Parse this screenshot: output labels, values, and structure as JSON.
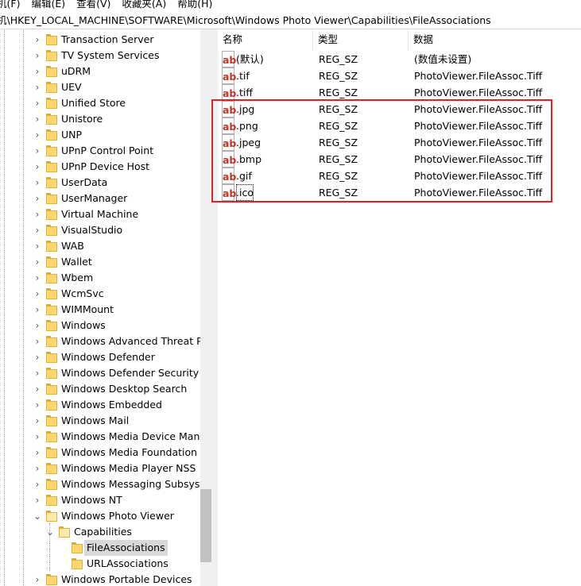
{
  "menu": [
    "机(F)",
    "编辑(E)",
    "查看(V)",
    "收藏夹(A)",
    "帮助(H)"
  ],
  "address": "机\\HKEY_LOCAL_MACHINE\\SOFTWARE\\Microsoft\\Windows Photo Viewer\\Capabilities\\FileAssociations",
  "tree": {
    "items": [
      {
        "label": "Transaction Server",
        "level": 1,
        "expand": "collapsed"
      },
      {
        "label": "TV System Services",
        "level": 1,
        "expand": "collapsed"
      },
      {
        "label": "uDRM",
        "level": 1,
        "expand": "collapsed"
      },
      {
        "label": "UEV",
        "level": 1,
        "expand": "collapsed"
      },
      {
        "label": "Unified Store",
        "level": 1,
        "expand": "collapsed"
      },
      {
        "label": "Unistore",
        "level": 1,
        "expand": "collapsed"
      },
      {
        "label": "UNP",
        "level": 1,
        "expand": "collapsed"
      },
      {
        "label": "UPnP Control Point",
        "level": 1,
        "expand": "collapsed"
      },
      {
        "label": "UPnP Device Host",
        "level": 1,
        "expand": "collapsed"
      },
      {
        "label": "UserData",
        "level": 1,
        "expand": "collapsed"
      },
      {
        "label": "UserManager",
        "level": 1,
        "expand": "collapsed"
      },
      {
        "label": "Virtual Machine",
        "level": 1,
        "expand": "collapsed"
      },
      {
        "label": "VisualStudio",
        "level": 1,
        "expand": "collapsed"
      },
      {
        "label": "WAB",
        "level": 1,
        "expand": "collapsed"
      },
      {
        "label": "Wallet",
        "level": 1,
        "expand": "collapsed"
      },
      {
        "label": "Wbem",
        "level": 1,
        "expand": "collapsed"
      },
      {
        "label": "WcmSvc",
        "level": 1,
        "expand": "collapsed"
      },
      {
        "label": "WIMMount",
        "level": 1,
        "expand": "collapsed"
      },
      {
        "label": "Windows",
        "level": 1,
        "expand": "collapsed"
      },
      {
        "label": "Windows Advanced Threat Pro",
        "level": 1,
        "expand": "collapsed"
      },
      {
        "label": "Windows Defender",
        "level": 1,
        "expand": "collapsed"
      },
      {
        "label": "Windows Defender Security C",
        "level": 1,
        "expand": "collapsed"
      },
      {
        "label": "Windows Desktop Search",
        "level": 1,
        "expand": "collapsed"
      },
      {
        "label": "Windows Embedded",
        "level": 1,
        "expand": "collapsed"
      },
      {
        "label": "Windows Mail",
        "level": 1,
        "expand": "collapsed"
      },
      {
        "label": "Windows Media Device Mana",
        "level": 1,
        "expand": "collapsed"
      },
      {
        "label": "Windows Media Foundation",
        "level": 1,
        "expand": "collapsed"
      },
      {
        "label": "Windows Media Player NSS",
        "level": 1,
        "expand": "collapsed"
      },
      {
        "label": "Windows Messaging Subsyste",
        "level": 1,
        "expand": "collapsed"
      },
      {
        "label": "Windows NT",
        "level": 1,
        "expand": "collapsed"
      },
      {
        "label": "Windows Photo Viewer",
        "level": 1,
        "expand": "expanded"
      },
      {
        "label": "Capabilities",
        "level": 2,
        "expand": "expanded"
      },
      {
        "label": "FileAssociations",
        "level": 3,
        "expand": "none",
        "selected": true
      },
      {
        "label": "URLAssociations",
        "level": 3,
        "expand": "none"
      },
      {
        "label": "Windows Portable Devices",
        "level": 1,
        "expand": "collapsed"
      }
    ]
  },
  "values": {
    "columns": {
      "name": "名称",
      "type": "类型",
      "data": "数据"
    },
    "icon": "ab-string-icon",
    "icon_text": "ab",
    "rows": [
      {
        "name": "(默认)",
        "type": "REG_SZ",
        "data": "(数值未设置)"
      },
      {
        "name": ".tif",
        "type": "REG_SZ",
        "data": "PhotoViewer.FileAssoc.Tiff"
      },
      {
        "name": ".tiff",
        "type": "REG_SZ",
        "data": "PhotoViewer.FileAssoc.Tiff"
      },
      {
        "name": ".jpg",
        "type": "REG_SZ",
        "data": "PhotoViewer.FileAssoc.Tiff"
      },
      {
        "name": ".png",
        "type": "REG_SZ",
        "data": "PhotoViewer.FileAssoc.Tiff"
      },
      {
        "name": ".jpeg",
        "type": "REG_SZ",
        "data": "PhotoViewer.FileAssoc.Tiff"
      },
      {
        "name": ".bmp",
        "type": "REG_SZ",
        "data": "PhotoViewer.FileAssoc.Tiff"
      },
      {
        "name": ".gif",
        "type": "REG_SZ",
        "data": "PhotoViewer.FileAssoc.Tiff"
      },
      {
        "name": ".ico",
        "type": "REG_SZ",
        "data": "PhotoViewer.FileAssoc.Tiff",
        "focused": true
      }
    ]
  },
  "annotation": {
    "color": "#d42626"
  }
}
